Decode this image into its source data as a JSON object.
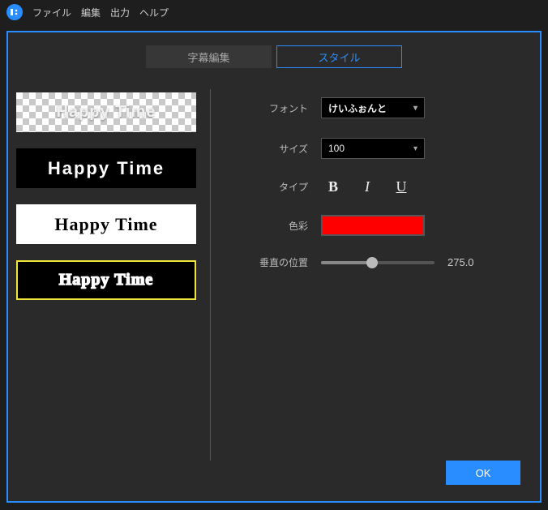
{
  "menu": {
    "file": "ファイル",
    "edit": "編集",
    "output": "出力",
    "help": "ヘルプ"
  },
  "tabs": {
    "subtitle": "字幕編集",
    "style": "スタイル"
  },
  "presets": {
    "sample_text": "Happy Time"
  },
  "form": {
    "font_label": "フォント",
    "font_value": "けいふぉんと",
    "size_label": "サイズ",
    "size_value": "100",
    "type_label": "タイプ",
    "bold": "B",
    "italic": "I",
    "underline": "U",
    "color_label": "色彩",
    "color_value": "#ff0000",
    "vpos_label": "垂直の位置",
    "vpos_value": "275.0",
    "vpos_pct": 45
  },
  "footer": {
    "ok": "OK"
  }
}
